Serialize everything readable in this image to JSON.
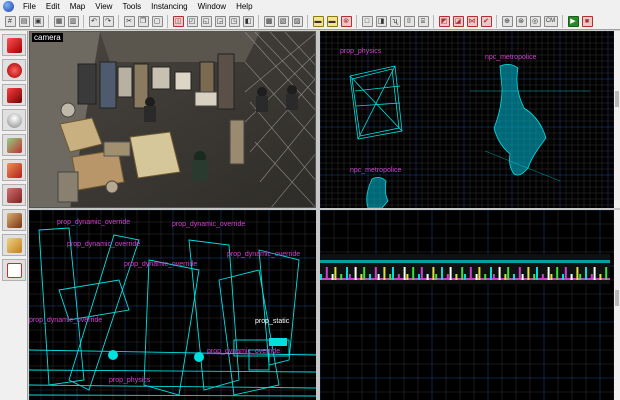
{
  "menu": {
    "items": [
      {
        "key": "file",
        "label": "File"
      },
      {
        "key": "edit",
        "label": "Edit"
      },
      {
        "key": "map",
        "label": "Map"
      },
      {
        "key": "view",
        "label": "View"
      },
      {
        "key": "tools",
        "label": "Tools"
      },
      {
        "key": "instancing",
        "label": "Instancing"
      },
      {
        "key": "window",
        "label": "Window"
      },
      {
        "key": "help",
        "label": "Help"
      }
    ]
  },
  "toolbar": {
    "cm_label": "CM"
  },
  "viewports": {
    "camera": {
      "label": "camera"
    },
    "top": {
      "entity_labels": [
        "prop_physics",
        "npc_metropolice",
        "npc_metropolice"
      ]
    },
    "side": {
      "entity_labels": [
        "prop_dynamic_override",
        "prop_dynamic_override",
        "prop_dynamic_override",
        "prop_dynamic_override",
        "prop_dynamic_override",
        "prop_dynamic_override",
        "prop_static",
        "prop_dynamic_override",
        "prop_physics"
      ]
    }
  },
  "colors": {
    "grid": "#303030",
    "grid_major": "#1a4a8a",
    "wire": "#00e0e0",
    "label": "#d040d0",
    "label_white": "#ffffff"
  }
}
